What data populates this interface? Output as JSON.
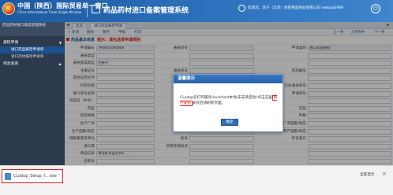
{
  "header": {
    "portal_title": "中国（陕西）国际贸易单一窗口",
    "portal_subtitle": "China International Trade Single Window",
    "system_title": "药品药材进口备案管理系统",
    "user_info": "欢迎您，李宁（北京）体育用品商业有限公司 swdjop0909",
    "power_glyph": "⏻"
  },
  "sidebar": {
    "heading": "药品药材进口备案管理系统",
    "groups": [
      {
        "label": "报检申请",
        "items": [
          "进口药品报检申请单",
          "进口药材报检申请单"
        ]
      },
      {
        "label": "综合查询",
        "items": []
      }
    ]
  },
  "tabs": {
    "prev": "◀",
    "items": [
      "首页",
      "进口药品报检申请"
    ],
    "next": "▶"
  },
  "toolbar": {
    "left": [
      "+ 新增",
      "删除",
      "暂存",
      "申报",
      "打印"
    ],
    "right": [
      "上一条",
      "上传附件",
      "下一条"
    ]
  },
  "form": {
    "section_title": "药品基本信息",
    "section_tip": "提示：请先选择申请类别",
    "rows": [
      [
        {
          "label": "申请编号"
        },
        {
          "value": "YP0820190006"
        },
        {
          "label": "通关单号"
        },
        {
          "value": ""
        },
        {
          "label": "申请类别"
        },
        {
          "value": "进口药品报检"
        }
      ],
      [
        {
          "label": "通关类型"
        },
        {
          "value": ""
        },
        {
          "label": ""
        },
        {
          "value": ""
        },
        {
          "label": ""
        },
        {
          "value": ""
        }
      ],
      [
        {
          "label": "通关备案类型"
        },
        {
          "value": "注册分"
        },
        {
          "label": ""
        },
        {
          "value": ""
        },
        {
          "label": ""
        },
        {
          "value": ""
        }
      ],
      [
        {
          "label": "注册证号"
        },
        {
          "value": ""
        },
        {
          "label": "通关单号"
        },
        {
          "value": ""
        },
        {
          "label": "药品编号"
        },
        {
          "value": ""
        }
      ],
      [
        {
          "label": "其他证明文件"
        },
        {
          "value": ""
        },
        {
          "label": ""
        },
        {
          "value": ""
        },
        {
          "label": ""
        },
        {
          "value": ""
        }
      ],
      [
        {
          "label": "付货负担"
        },
        {
          "value": ""
        },
        {
          "label": ""
        },
        {
          "value": ""
        },
        {
          "label": "已办通关单号"
        },
        {
          "value": ""
        }
      ],
      [
        {
          "label": "进口单位名称"
        },
        {
          "value": ""
        },
        {
          "label": ""
        },
        {
          "value": ""
        },
        {
          "label": "申请单位"
        },
        {
          "value": ""
        }
      ],
      [
        {
          "label": "商品名（中文）"
        },
        {
          "value": ""
        },
        {
          "label": ""
        },
        {
          "value": ""
        },
        {
          "label": ""
        },
        {
          "value": ""
        }
      ],
      [
        {
          "label": "剂型"
        },
        {
          "value": ""
        },
        {
          "label": "药品规格"
        },
        {
          "value": ""
        },
        {
          "label": "包装"
        },
        {
          "value": ""
        }
      ],
      [
        {
          "label": "包装规格"
        },
        {
          "value": ""
        },
        {
          "label": "数量"
        },
        {
          "value": ""
        },
        {
          "label": "件数"
        },
        {
          "value": ""
        }
      ],
      [
        {
          "label": "生产厂商"
        },
        {
          "value": ""
        },
        {
          "label": ""
        },
        {
          "value": ""
        },
        {
          "label": "生产厂商国家/地区"
        },
        {
          "value": ""
        }
      ],
      [
        {
          "label": "生产国家/地区"
        },
        {
          "value": ""
        },
        {
          "label": ""
        },
        {
          "value": ""
        },
        {
          "label": "原产国家/地区"
        },
        {
          "value": ""
        }
      ],
      [
        {
          "label": "预报重量及单位"
        },
        {
          "value": ""
        },
        {
          "label": "批号"
        },
        {
          "value": ""
        },
        {
          "label": "折合美元"
        },
        {
          "value": ""
        }
      ],
      [
        {
          "label": "进口港"
        },
        {
          "value": ""
        },
        {
          "label": "货物存放地点"
        },
        {
          "value": ""
        },
        {
          "label": ""
        },
        {
          "value": ""
        }
      ],
      [
        {
          "label": "商品信息"
        },
        {
          "value": "请选择货品名称/厂..."
        },
        {
          "label": ""
        },
        {
          "value": ""
        },
        {
          "label": ""
        },
        {
          "value": ""
        }
      ],
      [
        {
          "label": "合同号"
        },
        {
          "value": ""
        },
        {
          "label": ""
        },
        {
          "value": ""
        },
        {
          "label": ""
        },
        {
          "value": ""
        }
      ]
    ]
  },
  "dialog": {
    "title": "温馨提示",
    "message_pre": "CLodop云打印服务(localhost本地)未安装启动!点击这里",
    "message_link": "执行安装",
    "message_post": "安装后请刷新页面。",
    "ok_label": "确定"
  },
  "download_bar": {
    "file_name": "CLodop_Setup_f....exe",
    "caret": "⌃",
    "show_all": "全部显示",
    "close": "×"
  }
}
